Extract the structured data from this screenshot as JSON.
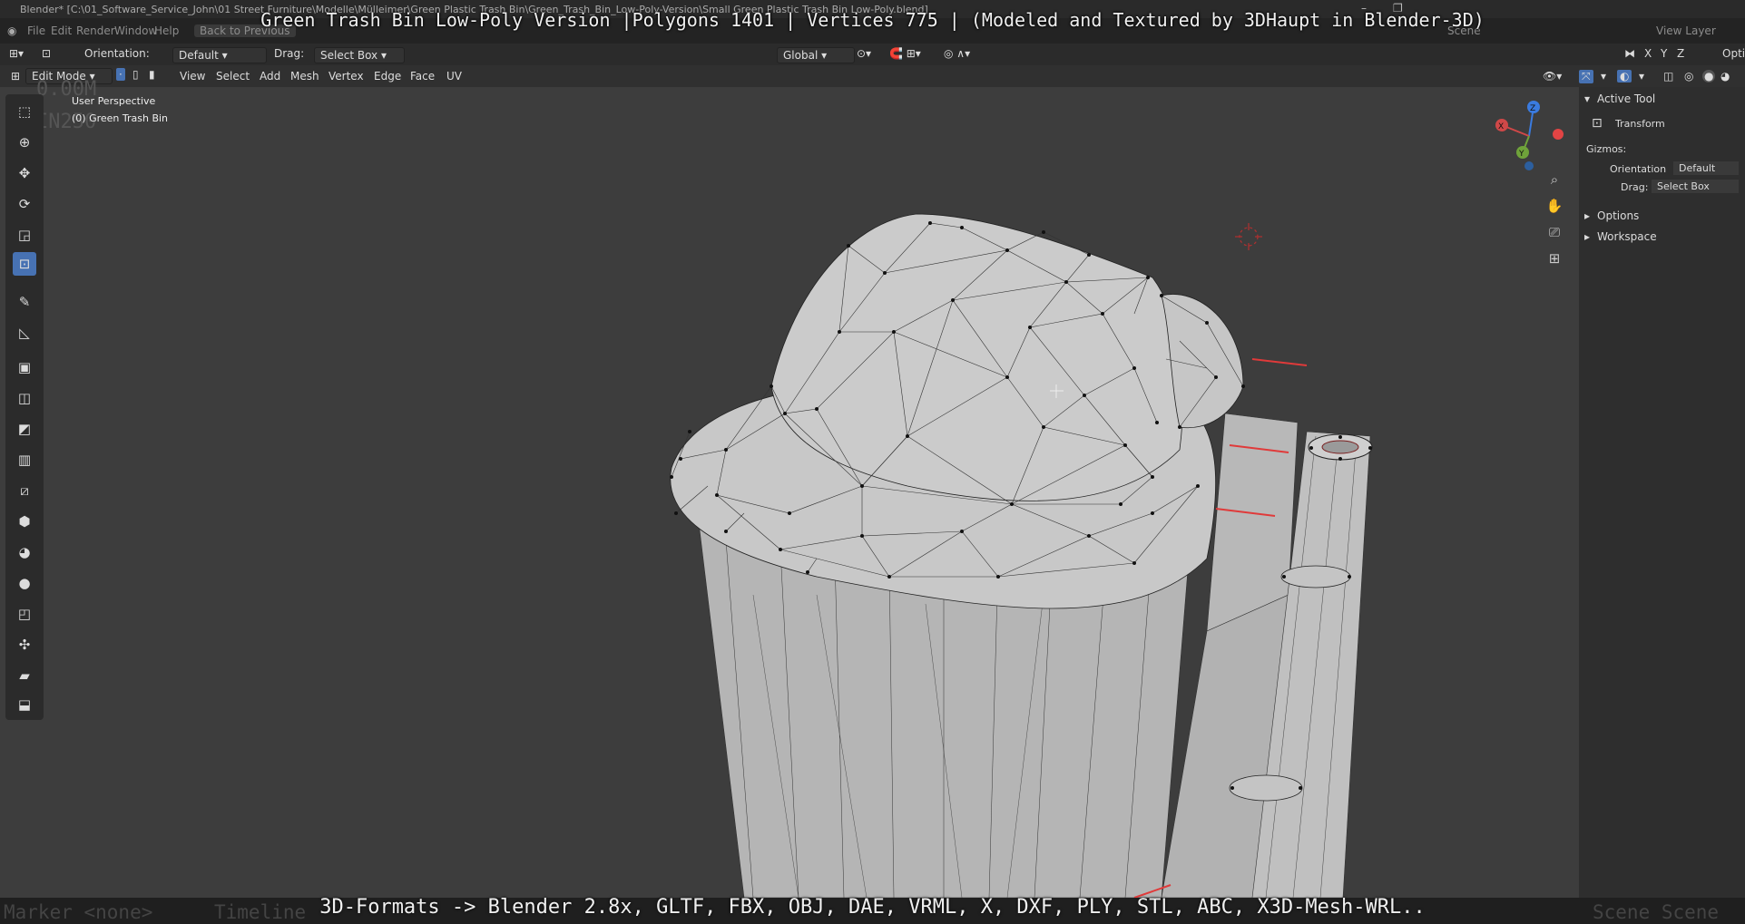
{
  "window": {
    "title": "Blender* [C:\\01_Software_Service_John\\01 Street Furniture\\Modelle\\Mülleimer\\Green Plastic Trash Bin\\Green_Trash_Bin_Low-Poly-Version\\Small Green Plastic Trash Bin Low-Poly.blend]",
    "minimize_icon": "minimize-icon",
    "restore_icon": "restore-icon"
  },
  "menubar": {
    "items": [
      "File",
      "Edit",
      "Render",
      "Window",
      "Help"
    ],
    "back_button": "Back to Previous",
    "scene_label": "Scene",
    "view_layer_label": "View Layer"
  },
  "overlay": {
    "title": "Green Trash Bin Low-Poly Version |Polygons 1401 | Vertices 775 | (Modeled and Textured by 3DHaupt in Blender-3D)",
    "bottom": "3D-Formats -> Blender 2.8x, GLTF, FBX, OBJ, DAE, VRML, X, DXF, PLY, STL, ABC, X3D-Mesh-WRL.."
  },
  "tool_header": {
    "orientation_label": "Orientation:",
    "orientation_value": "Default",
    "drag_label": "Drag:",
    "drag_value": "Select Box",
    "transform_orientation": "Global",
    "axis_x": "X",
    "axis_y": "Y",
    "axis_z": "Z",
    "options_label": "Optio"
  },
  "view_header": {
    "mode": "Edit Mode",
    "menus": [
      "View",
      "Select",
      "Add",
      "Mesh",
      "Vertex",
      "Edge",
      "Face",
      "UV"
    ]
  },
  "viewport": {
    "perspective": "User Perspective",
    "object": "(0) Green Trash Bin",
    "ghost_line1": "0.00M",
    "ghost_line2": "IN250",
    "gizmo_x": "X",
    "gizmo_y": "Y",
    "gizmo_z": "Z"
  },
  "tools": [
    {
      "name": "select-box-icon",
      "glyph": "⬚"
    },
    {
      "name": "cursor-icon",
      "glyph": "⊕"
    },
    {
      "name": "move-icon",
      "glyph": "✥"
    },
    {
      "name": "rotate-icon",
      "glyph": "⟳"
    },
    {
      "name": "scale-icon",
      "glyph": "◲"
    },
    {
      "name": "transform-icon",
      "glyph": "⊡"
    },
    {
      "name": "annotate-icon",
      "glyph": "✎"
    },
    {
      "name": "measure-icon",
      "glyph": "📐"
    },
    {
      "name": "extrude-icon",
      "glyph": "▣"
    },
    {
      "name": "inset-icon",
      "glyph": "◫"
    },
    {
      "name": "bevel-icon",
      "glyph": "◩"
    },
    {
      "name": "loop-cut-icon",
      "glyph": "▥"
    },
    {
      "name": "knife-icon",
      "glyph": "⧄"
    },
    {
      "name": "poly-build-icon",
      "glyph": "⬢"
    },
    {
      "name": "spin-icon",
      "glyph": "◕"
    },
    {
      "name": "smooth-icon",
      "glyph": "●"
    },
    {
      "name": "edge-slide-icon",
      "glyph": "◰"
    },
    {
      "name": "shrink-fatten-icon",
      "glyph": "✣"
    },
    {
      "name": "shear-icon",
      "glyph": "▰"
    },
    {
      "name": "rip-region-icon",
      "glyph": "⬓"
    }
  ],
  "npanel": {
    "active_tool_header": "Active Tool",
    "tool_name": "Transform",
    "gizmos_label": "Gizmos:",
    "orientation_label": "Orientation",
    "orientation_value": "Default",
    "drag_label": "Drag:",
    "drag_value": "Select Box",
    "options_section": "Options",
    "workspace_section": "Workspace"
  },
  "statusbar": {
    "ghost_left": "Marker <none>",
    "ghost_mid": "Timeline",
    "ghost_right": "Scene Scene"
  },
  "colors": {
    "accent": "#4772b3",
    "viewport_bg": "#3d3d3d",
    "mesh_fill": "#bdbdbd",
    "seam": "#e03a3a"
  }
}
